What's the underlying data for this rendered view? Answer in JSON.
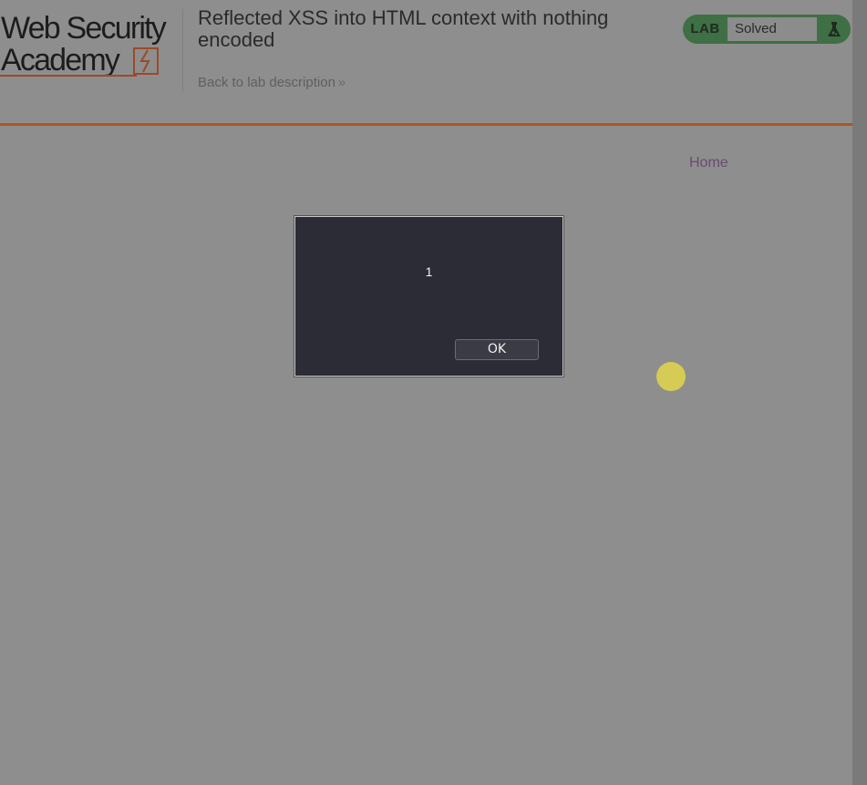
{
  "header": {
    "logo": {
      "line1": "Web Security",
      "line2": "Academy"
    },
    "lab_title": "Reflected XSS into HTML context with nothing encoded",
    "back_link": "Back to lab description",
    "back_link_icon": "double-chevron-right-icon"
  },
  "status": {
    "lab_label": "LAB",
    "status_text": "Solved",
    "icon": "flask-icon",
    "color": "#3f6f45"
  },
  "nav": {
    "home": "Home"
  },
  "dialog": {
    "message": "1",
    "ok_label": "OK"
  },
  "colors": {
    "accent": "#b2541f",
    "status_green": "#3f6f45",
    "link_purple": "#6b4a73",
    "cursor_highlight": "#d6cb55"
  }
}
